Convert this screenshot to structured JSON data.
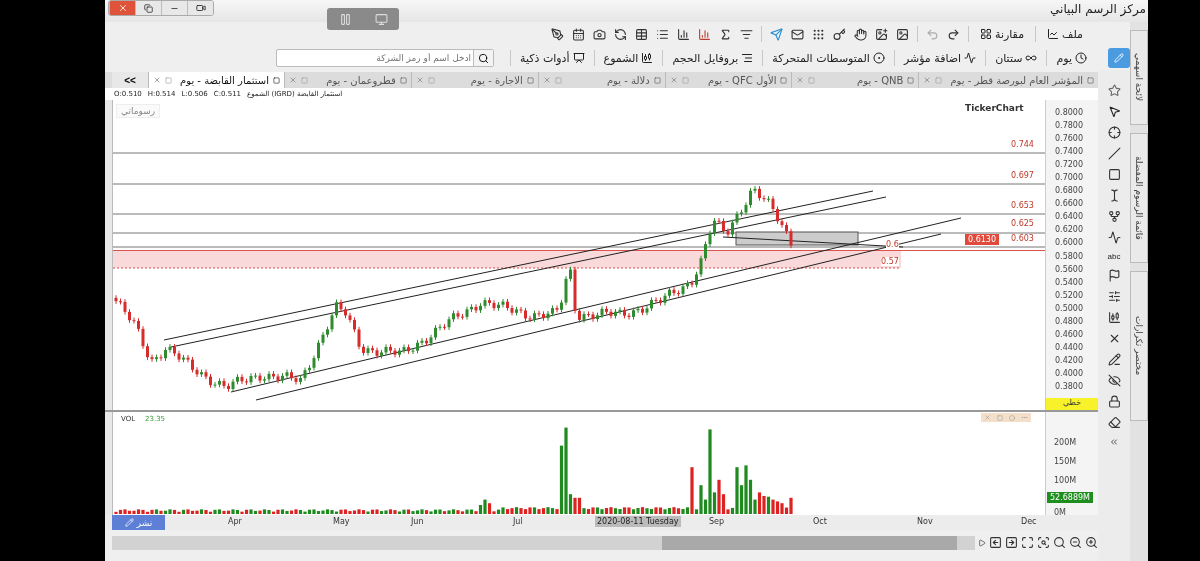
{
  "title_bar": {
    "title": "مركز الرسم البياني"
  },
  "toolbar_top": {
    "file": "ملف",
    "compare": "مقارنة"
  },
  "toolbar_main": {
    "draw_selected": true,
    "search": {
      "placeholder": "ادخل اسم أو رمز الشركة"
    },
    "items": [
      {
        "kind": "period",
        "label": "يوم"
      },
      {
        "kind": "type",
        "label": "ستتان"
      },
      {
        "kind": "indicator",
        "label": "اضافة مؤشر"
      },
      {
        "kind": "average",
        "label": "المتوسطات المتحركة"
      },
      {
        "kind": "profile",
        "label": "بروفايل الحجم"
      },
      {
        "kind": "candles",
        "label": "الشموع"
      },
      {
        "kind": "smart",
        "label": "أدوات ذكية"
      }
    ]
  },
  "tabs_overflow": ">>",
  "tabs": [
    {
      "label": "المؤشر العام لبورصة قطر - يوم",
      "selected": false
    },
    {
      "label": "QNB - يوم",
      "selected": false
    },
    {
      "label": "الأول QFC - يوم",
      "selected": false
    },
    {
      "label": "دلالة - يوم",
      "selected": false
    },
    {
      "label": "الاجارة - يوم",
      "selected": false
    },
    {
      "label": "قطروعمان - يوم",
      "selected": false
    },
    {
      "label": "استثمار القابضة - يوم",
      "selected": true
    }
  ],
  "info": {
    "name": "استثمار القابضة (IGRD) الشموع",
    "ohlc": [
      "C:0.511",
      "L:0.506",
      "H:0.514",
      "O:0.510"
    ]
  },
  "chart": {
    "drawings_label": "رسوماتي",
    "logo": "TickerChart",
    "last_price": "0.6130",
    "scale_mode": "خطي",
    "price_ticks": [
      "0.8000",
      "0.7800",
      "0.7600",
      "0.7400",
      "0.7200",
      "0.7000",
      "0.6800",
      "0.6600",
      "0.6400",
      "0.6200",
      "0.6000",
      "0.5800",
      "0.5600",
      "0.5400",
      "0.5200",
      "0.5000",
      "0.4800",
      "0.4600",
      "0.4400",
      "0.4200",
      "0.4000",
      "0.3800"
    ],
    "levels": [
      "0.744",
      "0.697",
      "0.653",
      "0.625",
      "0.603",
      "0.6",
      "0.57"
    ]
  },
  "volume": {
    "label": "VOL",
    "value": "23.35",
    "ticks": [
      "200M",
      "150M",
      "100M",
      "0M"
    ],
    "last_volume": "52.6889M"
  },
  "time_axis": {
    "months": [
      "Dec",
      "Nov",
      "Oct",
      "Sep",
      "Jul",
      "Jun",
      "May",
      "Apr"
    ],
    "cursor_date": "2020-08-11 Tuesday",
    "publish": "نشر"
  },
  "tools": {
    "text_tool": "abc"
  },
  "side_tabs": [
    "لائحة اسهمي",
    "قائمة الرسوم المفضلة",
    "مختصر تكرارات"
  ]
}
